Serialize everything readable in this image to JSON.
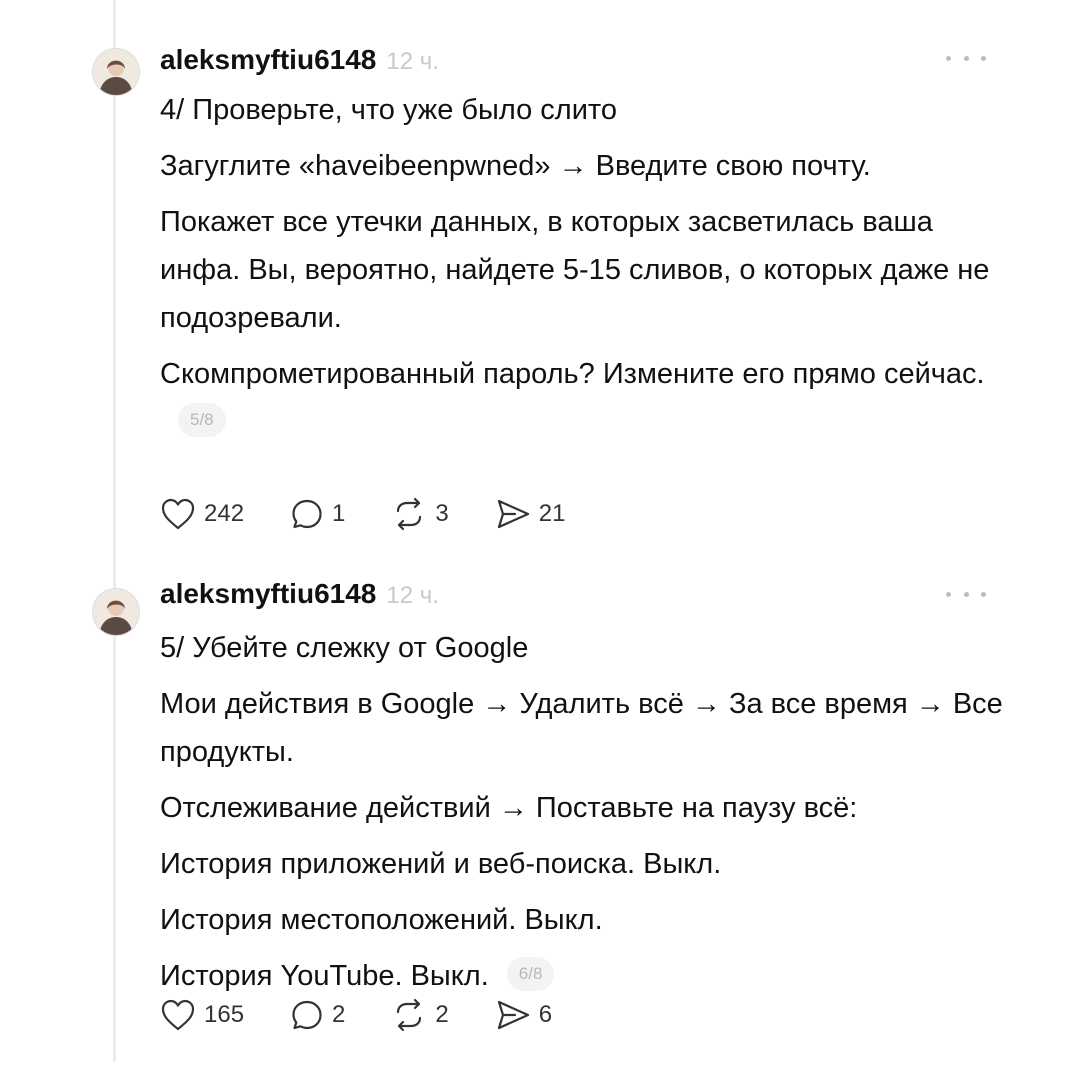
{
  "posts": [
    {
      "username": "aleksmyftiu6148",
      "time": "12 ч.",
      "title": "4/ Проверьте, что уже было слито",
      "paragraphs": [
        "Загуглите «haveibeenpwned» → Введите свою почту.",
        "Покажет все утечки данных, в которых засветилась ваша инфа. Вы, вероятно, найдете 5-15 сливов, о которых даже не подозревали.",
        "Скомпрометированный пароль? Измените его прямо сейчас."
      ],
      "page": "5/8",
      "likes": "242",
      "replies": "1",
      "reposts": "3",
      "shares": "21"
    },
    {
      "username": "aleksmyftiu6148",
      "time": "12 ч.",
      "title": "5/ Убейте слежку от Google",
      "paragraphs": [
        "Мои действия в Google → Удалить всё → За все время → Все продукты.",
        "Отслеживание действий → Поставьте на паузу всё:",
        "История приложений и веб-поиска. Выкл.",
        "История местоположений. Выкл.",
        "История YouTube. Выкл."
      ],
      "page": "6/8",
      "likes": "165",
      "replies": "2",
      "reposts": "2",
      "shares": "6"
    }
  ],
  "icons": {
    "like": "heart-icon",
    "reply": "comment-icon",
    "repost": "repost-icon",
    "share": "send-icon",
    "more": "more-icon"
  },
  "colors": {
    "text": "#111111",
    "muted": "#c9c9c9",
    "thread_line": "#ececec"
  }
}
